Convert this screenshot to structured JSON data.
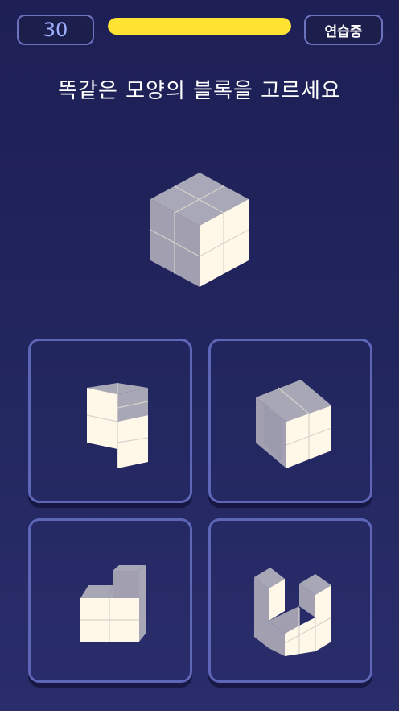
{
  "header": {
    "score": "30",
    "timer_fraction": 1.0,
    "mode_label": "연습중"
  },
  "prompt": "똑같은 모양의 블록을 고르세요",
  "colors": {
    "background": "#1d1f55",
    "timer": "#ffe333",
    "cube_front": "#fff7e6",
    "cube_top": "#a8a7b6",
    "cube_side": "#a4a2b2",
    "option_border": "#5e66b8"
  },
  "target_block": {
    "icon": "cube-2x2x2-icon"
  },
  "options": [
    {
      "id": "a",
      "icon": "block-stair-right-icon"
    },
    {
      "id": "b",
      "icon": "block-cube-notched-icon"
    },
    {
      "id": "c",
      "icon": "block-stair-left-icon"
    },
    {
      "id": "d",
      "icon": "block-u-shape-icon"
    }
  ]
}
